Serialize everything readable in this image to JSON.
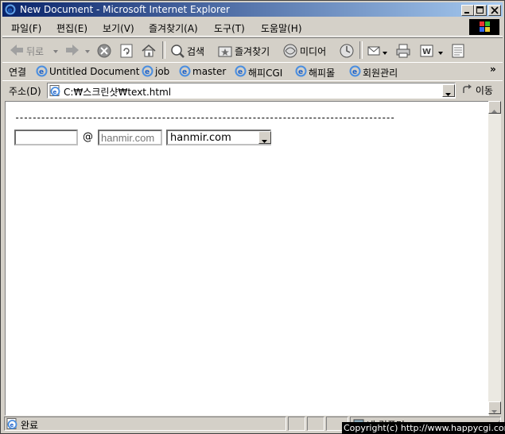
{
  "window": {
    "title": "New Document - Microsoft Internet Explorer"
  },
  "menu": [
    "파일(F)",
    "편집(E)",
    "보기(V)",
    "즐겨찾기(A)",
    "도구(T)",
    "도움말(H)"
  ],
  "toolbar": {
    "back": "뒤로",
    "search": "검색",
    "favorites": "즐겨찾기",
    "media": "미디어"
  },
  "links": {
    "label": "연결",
    "items": [
      "Untitled Document",
      "job",
      "master",
      "해피CGI",
      "해피몰",
      "회원관리"
    ],
    "more": "»"
  },
  "address": {
    "label": "주소(D)",
    "value": "C:₩스크린샷₩text.html",
    "go": "이동"
  },
  "content": {
    "dashes": "----------------------------------------------------------------------------------------",
    "email_user_value": "",
    "at": "@",
    "domain_placeholder": "hanmir.com",
    "domain_select_value": "hanmir.com"
  },
  "status": {
    "text": "완료",
    "zone": "내 컴퓨터"
  },
  "overlay": {
    "copyright": "Copyright(c) http://www.happycgi.com"
  },
  "colors": {
    "titlebar_start": "#0a246a",
    "titlebar_end": "#a6caf0",
    "chrome": "#d4d0c8"
  }
}
